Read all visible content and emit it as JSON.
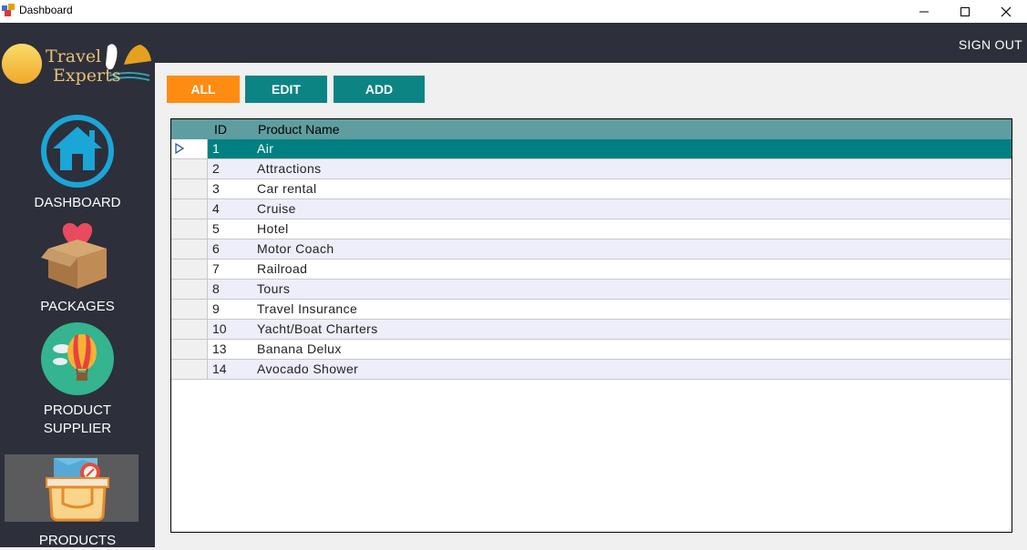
{
  "window": {
    "title": "Dashboard"
  },
  "header": {
    "signout_label": "SIGN OUT"
  },
  "sidebar": {
    "logo_text_line1": "Travel",
    "logo_text_line2": "Experts",
    "items": [
      {
        "label": "DASHBOARD",
        "icon": "home-icon"
      },
      {
        "label": "PACKAGES",
        "icon": "heart-box-icon"
      },
      {
        "label_line1": "PRODUCT",
        "label_line2": "SUPPLIER",
        "icon": "hot-air-balloon-icon"
      },
      {
        "label": "PRODUCTS",
        "icon": "travel-bag-map-icon"
      }
    ]
  },
  "toolbar": {
    "all_label": "ALL",
    "edit_label": "EDIT",
    "add_label": "ADD"
  },
  "table": {
    "columns": [
      "ID",
      "Product Name"
    ],
    "rows": [
      {
        "id": "1",
        "name": "Air"
      },
      {
        "id": "2",
        "name": "Attractions"
      },
      {
        "id": "3",
        "name": "Car rental"
      },
      {
        "id": "4",
        "name": "Cruise"
      },
      {
        "id": "5",
        "name": "Hotel"
      },
      {
        "id": "6",
        "name": "Motor Coach"
      },
      {
        "id": "7",
        "name": "Railroad"
      },
      {
        "id": "8",
        "name": "Tours"
      },
      {
        "id": "9",
        "name": "Travel Insurance"
      },
      {
        "id": "10",
        "name": "Yacht/Boat Charters"
      },
      {
        "id": "13",
        "name": "Banana Delux"
      },
      {
        "id": "14",
        "name": "Avocado Shower"
      }
    ]
  },
  "colors": {
    "accent_orange": "#ff8c12",
    "accent_teal": "#0d8484",
    "header_teal": "#5f9ea0",
    "sidebar_bg": "#2d2f3a"
  }
}
